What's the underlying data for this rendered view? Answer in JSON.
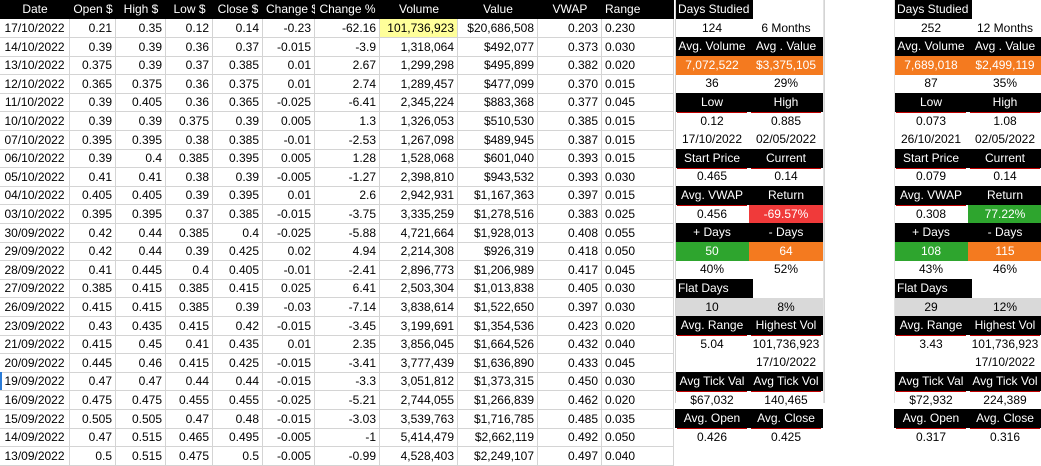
{
  "table": {
    "headers": [
      "Date",
      "Open $",
      "High $",
      "Low $",
      "Close $",
      "Change $",
      "Change %",
      "Volume",
      "Value",
      "VWAP",
      "Range"
    ],
    "rows": [
      [
        "17/10/2022",
        "0.21",
        "0.35",
        "0.12",
        "0.14",
        "-0.23",
        "-62.16",
        "101,736,923",
        "$20,686,508",
        "0.203",
        "0.230"
      ],
      [
        "14/10/2022",
        "0.39",
        "0.39",
        "0.36",
        "0.37",
        "-0.015",
        "-3.9",
        "1,318,064",
        "$492,077",
        "0.373",
        "0.030"
      ],
      [
        "13/10/2022",
        "0.375",
        "0.39",
        "0.37",
        "0.385",
        "0.01",
        "2.67",
        "1,299,298",
        "$495,899",
        "0.382",
        "0.020"
      ],
      [
        "12/10/2022",
        "0.365",
        "0.375",
        "0.36",
        "0.375",
        "0.01",
        "2.74",
        "1,289,457",
        "$477,099",
        "0.370",
        "0.015"
      ],
      [
        "11/10/2022",
        "0.39",
        "0.405",
        "0.36",
        "0.365",
        "-0.025",
        "-6.41",
        "2,345,224",
        "$883,368",
        "0.377",
        "0.045"
      ],
      [
        "10/10/2022",
        "0.39",
        "0.39",
        "0.375",
        "0.39",
        "0.005",
        "1.3",
        "1,326,053",
        "$510,530",
        "0.385",
        "0.015"
      ],
      [
        "07/10/2022",
        "0.395",
        "0.395",
        "0.38",
        "0.385",
        "-0.01",
        "-2.53",
        "1,267,098",
        "$489,945",
        "0.387",
        "0.015"
      ],
      [
        "06/10/2022",
        "0.39",
        "0.4",
        "0.385",
        "0.395",
        "0.005",
        "1.28",
        "1,528,068",
        "$601,040",
        "0.393",
        "0.015"
      ],
      [
        "05/10/2022",
        "0.41",
        "0.41",
        "0.38",
        "0.39",
        "-0.005",
        "-1.27",
        "2,398,810",
        "$943,532",
        "0.393",
        "0.030"
      ],
      [
        "04/10/2022",
        "0.405",
        "0.405",
        "0.39",
        "0.395",
        "0.01",
        "2.6",
        "2,942,931",
        "$1,167,363",
        "0.397",
        "0.015"
      ],
      [
        "03/10/2022",
        "0.395",
        "0.395",
        "0.37",
        "0.385",
        "-0.015",
        "-3.75",
        "3,335,259",
        "$1,278,516",
        "0.383",
        "0.025"
      ],
      [
        "30/09/2022",
        "0.42",
        "0.44",
        "0.385",
        "0.4",
        "-0.025",
        "-5.88",
        "4,721,664",
        "$1,928,013",
        "0.408",
        "0.055"
      ],
      [
        "29/09/2022",
        "0.42",
        "0.44",
        "0.39",
        "0.425",
        "0.02",
        "4.94",
        "2,214,308",
        "$926,319",
        "0.418",
        "0.050"
      ],
      [
        "28/09/2022",
        "0.41",
        "0.445",
        "0.4",
        "0.405",
        "-0.01",
        "-2.41",
        "2,896,773",
        "$1,206,989",
        "0.417",
        "0.045"
      ],
      [
        "27/09/2022",
        "0.385",
        "0.415",
        "0.385",
        "0.415",
        "0.025",
        "6.41",
        "2,503,304",
        "$1,013,838",
        "0.405",
        "0.030"
      ],
      [
        "26/09/2022",
        "0.415",
        "0.415",
        "0.385",
        "0.39",
        "-0.03",
        "-7.14",
        "3,838,614",
        "$1,522,650",
        "0.397",
        "0.030"
      ],
      [
        "23/09/2022",
        "0.43",
        "0.435",
        "0.415",
        "0.42",
        "-0.015",
        "-3.45",
        "3,199,691",
        "$1,354,536",
        "0.423",
        "0.020"
      ],
      [
        "21/09/2022",
        "0.415",
        "0.45",
        "0.41",
        "0.435",
        "0.01",
        "2.35",
        "3,856,045",
        "$1,664,526",
        "0.432",
        "0.040"
      ],
      [
        "20/09/2022",
        "0.445",
        "0.46",
        "0.415",
        "0.425",
        "-0.015",
        "-3.41",
        "3,777,439",
        "$1,636,890",
        "0.433",
        "0.045"
      ],
      [
        "19/09/2022",
        "0.47",
        "0.47",
        "0.44",
        "0.44",
        "-0.015",
        "-3.3",
        "3,051,812",
        "$1,373,315",
        "0.450",
        "0.030"
      ],
      [
        "16/09/2022",
        "0.475",
        "0.475",
        "0.455",
        "0.455",
        "-0.025",
        "-5.21",
        "2,744,055",
        "$1,266,839",
        "0.462",
        "0.020"
      ],
      [
        "15/09/2022",
        "0.505",
        "0.505",
        "0.47",
        "0.48",
        "-0.015",
        "-3.03",
        "3,539,763",
        "$1,716,785",
        "0.485",
        "0.035"
      ],
      [
        "14/09/2022",
        "0.47",
        "0.515",
        "0.465",
        "0.495",
        "-0.005",
        "-1",
        "5,414,479",
        "$2,662,119",
        "0.492",
        "0.050"
      ],
      [
        "13/09/2022",
        "0.5",
        "0.515",
        "0.475",
        "0.5",
        "-0.005",
        "-0.99",
        "4,528,403",
        "$2,249,107",
        "0.497",
        "0.040"
      ]
    ]
  },
  "stats6": {
    "days_label": "Days Studied",
    "days": "124",
    "period": "6 Months",
    "avg_vol_label": "Avg. Volume",
    "avg_val_label": "Avg . Value",
    "avg_vol": "7,072,522",
    "avg_val": "$3,375,105",
    "c36": "36",
    "p29": "29%",
    "low_label": "Low",
    "high_label": "High",
    "low": "0.12",
    "high": "0.885",
    "low_date": "17/10/2022",
    "high_date": "02/05/2022",
    "start_label": "Start Price",
    "current_label": "Current",
    "start": "0.465",
    "current": "0.14",
    "vwap_label": "Avg. VWAP",
    "return_label": "Return",
    "vwap": "0.456",
    "ret": "-69.57%",
    "plus_label": "+ Days",
    "minus_label": "- Days",
    "plus": "50",
    "minus": "64",
    "plus_pct": "40%",
    "minus_pct": "52%",
    "flat_label": "Flat Days",
    "flat": "10",
    "flat_pct": "8%",
    "avg_range_label": "Avg. Range",
    "highest_vol_label": "Highest Vol",
    "avg_range": "5.04",
    "highest_vol": "101,736,923",
    "highest_vol_date": "17/10/2022",
    "tick_val_label": "Avg Tick Val",
    "tick_vol_label": "Avg Tick Vol",
    "tick_val": "$67,032",
    "tick_vol": "140,465",
    "avg_open_label": "Avg. Open",
    "avg_close_label": "Avg. Close",
    "avg_open": "0.426",
    "avg_close": "0.425"
  },
  "stats12": {
    "days_label": "Days Studied",
    "days": "252",
    "period": "12 Months",
    "avg_vol_label": "Avg. Volume",
    "avg_val_label": "Avg . Value",
    "avg_vol": "7,689,018",
    "avg_val": "$2,499,119",
    "c36": "87",
    "p29": "35%",
    "low_label": "Low",
    "high_label": "High",
    "low": "0.073",
    "high": "1.08",
    "low_date": "26/10/2021",
    "high_date": "02/05/2022",
    "start_label": "Start Price",
    "current_label": "Current",
    "start": "0.079",
    "current": "0.14",
    "vwap_label": "Avg. VWAP",
    "return_label": "Return",
    "vwap": "0.308",
    "ret": "77.22%",
    "plus_label": "+ Days",
    "minus_label": "- Days",
    "plus": "108",
    "minus": "115",
    "plus_pct": "43%",
    "minus_pct": "46%",
    "flat_label": "Flat Days",
    "flat": "29",
    "flat_pct": "12%",
    "avg_range_label": "Avg. Range",
    "highest_vol_label": "Highest Vol",
    "avg_range": "3.43",
    "highest_vol": "101,736,923",
    "highest_vol_date": "17/10/2022",
    "tick_val_label": "Avg Tick Val",
    "tick_vol_label": "Avg Tick Vol",
    "tick_val": "$72,932",
    "tick_vol": "224,389",
    "avg_open_label": "Avg. Open",
    "avg_close_label": "Avg. Close",
    "avg_open": "0.317",
    "avg_close": "0.316"
  },
  "colors": {
    "header_bg": "#000000",
    "highlight_yellow": "#ffff9a",
    "orange": "#f47a1f",
    "red": "#f03a3a",
    "green": "#2ea52e",
    "grey": "#d9d9d9"
  }
}
